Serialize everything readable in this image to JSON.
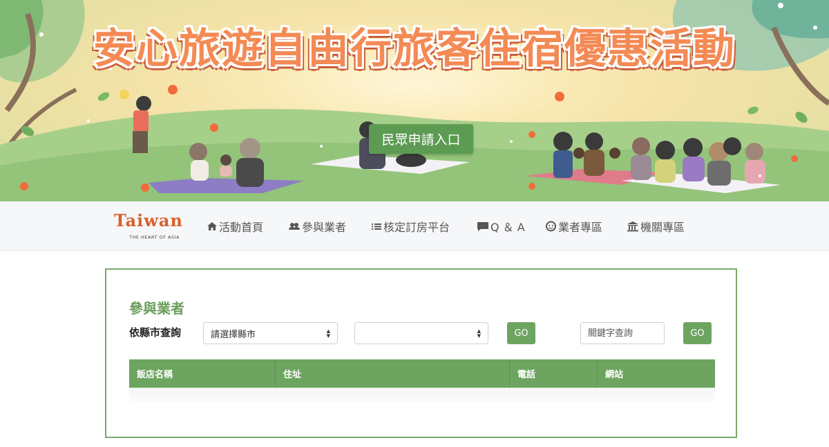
{
  "banner": {
    "title": "安心旅遊自由行旅客住宿優惠活動",
    "cta_label": "民眾申請入口"
  },
  "logo": {
    "word": "Taiwan",
    "tagline": "THE HEART OF ASIA"
  },
  "nav": {
    "items": [
      {
        "label": "活動首頁",
        "icon": "home-icon"
      },
      {
        "label": "參與業者",
        "icon": "users-icon"
      },
      {
        "label": "核定訂房平台",
        "icon": "list-icon"
      },
      {
        "label": "Q ＆ A",
        "icon": "chat-icon"
      },
      {
        "label": "業者專區",
        "icon": "face-icon"
      },
      {
        "label": "機關專區",
        "icon": "institution-icon"
      }
    ]
  },
  "main": {
    "section_title": "參與業者",
    "filter_label": "依縣市查詢",
    "county_select": {
      "selected": "請選擇縣市"
    },
    "district_select": {
      "selected": ""
    },
    "go_label_1": "GO",
    "keyword_placeholder": "關鍵字查詢",
    "go_label_2": "GO",
    "table": {
      "columns": [
        "飯店名稱",
        "住址",
        "電話",
        "網站"
      ],
      "rows": []
    }
  },
  "colors": {
    "primary_green": "#6da460",
    "title_orange": "#f48a54",
    "logo_orange": "#d9602b"
  }
}
